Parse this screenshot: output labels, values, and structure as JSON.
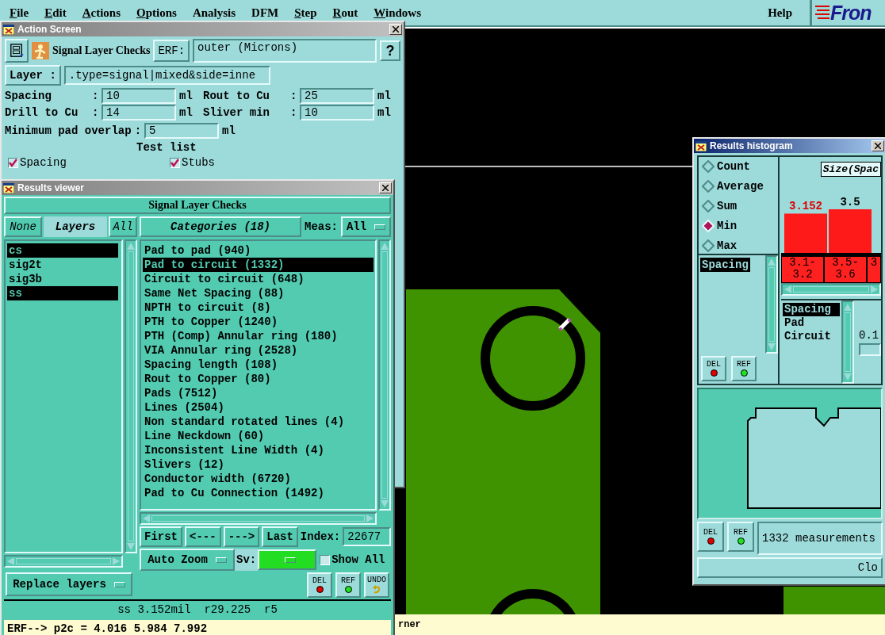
{
  "menu_bar": {
    "items": [
      {
        "label": "File",
        "mnemonic": true
      },
      {
        "label": "Edit",
        "mnemonic": true
      },
      {
        "label": "Actions",
        "mnemonic": true
      },
      {
        "label": "Options",
        "mnemonic": true
      },
      {
        "label": "Analysis",
        "mnemonic": false
      },
      {
        "label": "DFM",
        "mnemonic": false
      },
      {
        "label": "Step",
        "mnemonic": true
      },
      {
        "label": "Rout",
        "mnemonic": true
      },
      {
        "label": "Windows",
        "mnemonic": true
      }
    ],
    "help": "Help",
    "logo": "Fron"
  },
  "action_screen": {
    "title": "Action Screen",
    "active": false,
    "heading": "Signal Layer Checks",
    "erf_button": "ERF:",
    "erf_value": "outer (Microns)",
    "help_button": "?",
    "layer_button": "Layer :",
    "layer_value": ".type=signal|mixed&side=inne",
    "params": [
      {
        "label": "Spacing",
        "sep": ":",
        "value": "10",
        "unit": "ml"
      },
      {
        "label": "Rout to Cu",
        "sep": ":",
        "value": "25",
        "unit": "ml"
      },
      {
        "label": "Drill to Cu",
        "sep": ":",
        "value": "14",
        "unit": "ml"
      },
      {
        "label": "Sliver min",
        "sep": ":",
        "value": "10",
        "unit": "ml"
      }
    ],
    "overlap": {
      "label": "Minimum pad overlap",
      "sep": ":",
      "value": "5",
      "unit": "ml"
    },
    "test_list_label": "Test list",
    "tests": [
      {
        "label": "Spacing",
        "checked": true
      },
      {
        "label": "Stubs",
        "checked": true
      }
    ]
  },
  "results_viewer": {
    "title": "Results viewer",
    "active": false,
    "header": "Signal Layer Checks",
    "none_button": "None",
    "layers_label": "Layers",
    "all_button": "All",
    "layers": [
      {
        "name": "cs",
        "selected": true
      },
      {
        "name": "sig2t",
        "selected": false
      },
      {
        "name": "sig3b",
        "selected": false
      },
      {
        "name": "ss",
        "selected": true
      }
    ],
    "replace_menu": "Replace layers",
    "categories_button": "Categories (18)",
    "meas_label": "Meas:",
    "meas_menu": "All",
    "categories": [
      {
        "label": "Pad to pad (940)",
        "selected": false
      },
      {
        "label": "Pad to circuit (1332)",
        "selected": true
      },
      {
        "label": "Circuit to circuit (648)",
        "selected": false
      },
      {
        "label": "Same Net Spacing (88)",
        "selected": false
      },
      {
        "label": "NPTH to circuit (8)",
        "selected": false
      },
      {
        "label": "PTH to Copper (1240)",
        "selected": false
      },
      {
        "label": "PTH (Comp) Annular ring (180)",
        "selected": false
      },
      {
        "label": "VIA Annular ring (2528)",
        "selected": false
      },
      {
        "label": "Spacing length (108)",
        "selected": false
      },
      {
        "label": "Rout to Copper (80)",
        "selected": false
      },
      {
        "label": "Pads (7512)",
        "selected": false
      },
      {
        "label": "Lines (2504)",
        "selected": false
      },
      {
        "label": "Non standard rotated lines (4)",
        "selected": false
      },
      {
        "label": "Line Neckdown (60)",
        "selected": false
      },
      {
        "label": "Inconsistent Line Width (4)",
        "selected": false
      },
      {
        "label": "Slivers (12)",
        "selected": false
      },
      {
        "label": "Conductor width (6720)",
        "selected": false
      },
      {
        "label": "Pad to Cu Connection (1492)",
        "selected": false
      }
    ],
    "nav": [
      "First",
      "<---",
      "--->",
      "Last"
    ],
    "index_label": "Index:",
    "index_value": "22677",
    "zoom_menu": "Auto Zoom",
    "sv_label": "Sv:",
    "show_all": {
      "label": "Show All",
      "checked": false
    },
    "tool_buttons": [
      {
        "label": "DEL",
        "kind": "delete"
      },
      {
        "label": "REF",
        "kind": "refresh"
      },
      {
        "label": "UNDO",
        "kind": "undo"
      }
    ],
    "status": "ss 3.152mil  r29.225  r5",
    "command_line": "ERF--> p2c = 4.016 5.984 7.992"
  },
  "histogram": {
    "title": "Results histogram",
    "active": true,
    "modes": [
      {
        "label": "Count",
        "selected": false
      },
      {
        "label": "Average",
        "selected": false
      },
      {
        "label": "Sum",
        "selected": false
      },
      {
        "label": "Min",
        "selected": true
      },
      {
        "label": "Max",
        "selected": false
      }
    ],
    "tests": [
      {
        "label": "Spacing",
        "selected": true
      }
    ],
    "buttons": [
      {
        "label": "DEL",
        "kind": "delete"
      },
      {
        "label": "REF",
        "kind": "refresh"
      }
    ],
    "chart_data": {
      "type": "bar",
      "title": "Size(Spac",
      "categories": [
        "3.1-3.2",
        "3.5-3.6",
        "3"
      ],
      "values": [
        3.152,
        3.5,
        null
      ],
      "data_labels": true
    },
    "measures": [
      {
        "label": "Spacing",
        "selected": true
      },
      {
        "label": "Pad",
        "selected": false
      },
      {
        "label": "Circuit",
        "selected": false
      }
    ],
    "scale_value": "0.1",
    "bottom_buttons": [
      {
        "label": "DEL",
        "kind": "delete"
      },
      {
        "label": "REF",
        "kind": "refresh"
      }
    ],
    "summary": "1332 measurements",
    "close_button": "Clo"
  },
  "status_bar": {
    "text": "rner"
  }
}
